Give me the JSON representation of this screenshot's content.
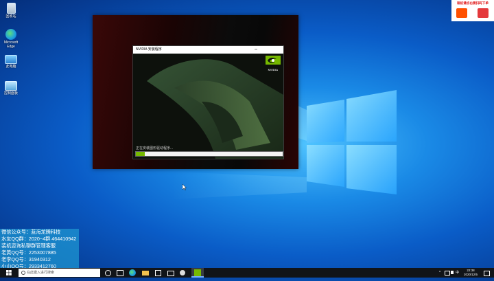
{
  "desktop": {
    "icons": [
      {
        "name": "recycle-bin",
        "label": "回收站"
      },
      {
        "name": "microsoft-edge",
        "label": "Microsoft Edge"
      },
      {
        "name": "this-pc",
        "label": "此电脑"
      },
      {
        "name": "control-panel",
        "label": "控制面板"
      }
    ]
  },
  "installer": {
    "title": "NVIDIA 安装程序",
    "minimize_glyph": "–",
    "logo_text": "NVIDIA",
    "status": "正在安装图形驱动程序...",
    "progress": 0.06
  },
  "ad": {
    "text": "装机请点右侧扫码下单"
  },
  "info_panel": {
    "lines": [
      "微信公众号：蓝海龙腾科技",
      "水友QQ群：2020~4群  464410942",
      "装机咨询私聊群管理客服",
      "老黄QQ号：2253007885",
      "老李QQ号：31940312",
      "小山QQ号：2933412760"
    ]
  },
  "taskbar": {
    "search_placeholder": "在此键入进行搜索",
    "tray_lang": "中",
    "time": "22:38",
    "date": "2020/12/5"
  },
  "colors": {
    "nvidia_green": "#76b900",
    "taskbar": "#111418"
  }
}
